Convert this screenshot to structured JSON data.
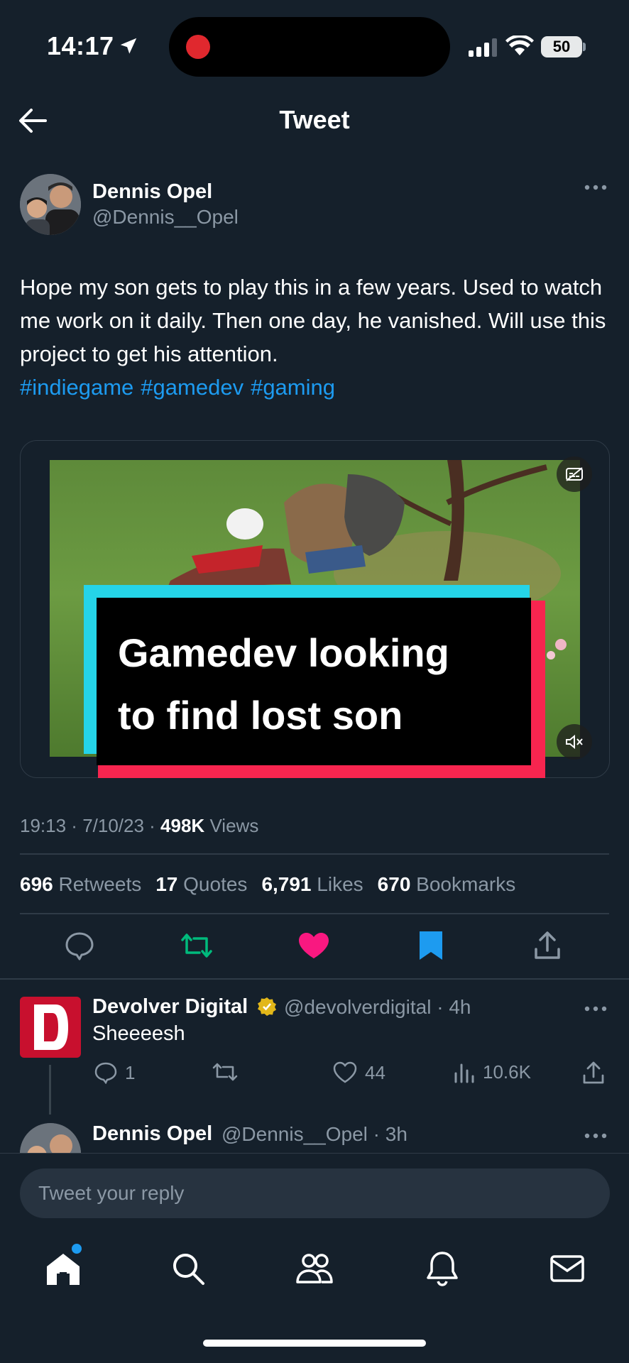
{
  "status_bar": {
    "time": "14:17",
    "battery": "50"
  },
  "header": {
    "title": "Tweet"
  },
  "tweet": {
    "author_name": "Dennis Opel",
    "author_handle": "@Dennis__Opel",
    "text": "Hope my son gets to play this in a few years. Used to watch me work on it daily. Then one day, he vanished. Will use this project to get his attention.",
    "hashtags": [
      "#indiegame",
      "#gamedev",
      "#gaming"
    ],
    "media_caption_line1": "Gamedev looking",
    "media_caption_line2": "to find lost son",
    "time": "19:13",
    "date": "7/10/23",
    "views_count": "498K",
    "views_label": "Views",
    "stats": {
      "retweets_count": "696",
      "retweets_label": "Retweets",
      "quotes_count": "17",
      "quotes_label": "Quotes",
      "likes_count": "6,791",
      "likes_label": "Likes",
      "bookmarks_count": "670",
      "bookmarks_label": "Bookmarks"
    },
    "liked": true,
    "bookmarked": true
  },
  "replies": [
    {
      "author_name": "Devolver Digital",
      "verified": true,
      "author_handle": "@devolverdigital",
      "age": "4h",
      "text": "Sheeeesh",
      "reply_count": "1",
      "like_count": "44",
      "view_count": "10.6K"
    },
    {
      "author_name": "Dennis Opel",
      "author_handle": "@Dennis__Opel",
      "age": "3h"
    }
  ],
  "compose": {
    "placeholder": "Tweet your reply"
  },
  "colors": {
    "background": "#15202b",
    "accent": "#1d9bf0",
    "like": "#f91880",
    "retweet": "#00ba7c",
    "muted": "#8b98a5"
  }
}
